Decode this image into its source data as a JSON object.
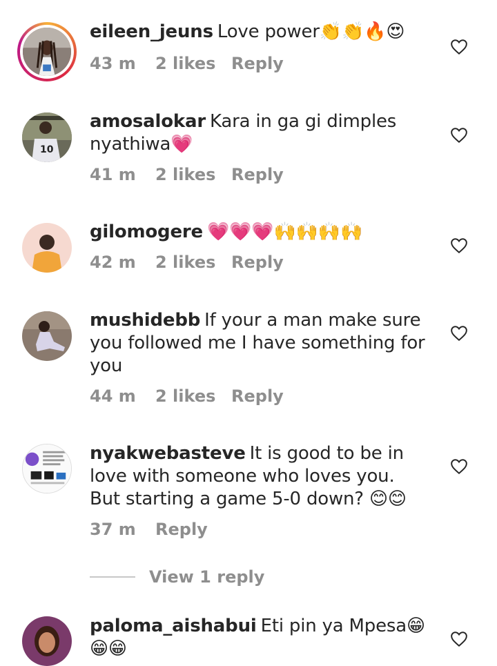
{
  "comments": [
    {
      "username": "eileen_jeuns",
      "text": "Love power",
      "emojis": "👏👏🔥😍",
      "time": "43 m",
      "likes": "2 likes",
      "reply": "Reply",
      "has_story": true,
      "avatar_icon": "avatar-photo-woman-braids"
    },
    {
      "username": "amosalokar",
      "text": "Kara in ga gi dimples nyathiwa",
      "emojis": "💗",
      "time": "41 m",
      "likes": "2 likes",
      "reply": "Reply",
      "has_story": false,
      "avatar_icon": "avatar-photo-jersey-10"
    },
    {
      "username": "gilomogere",
      "text": "",
      "emojis": "💗💗💗🙌🙌🙌🙌",
      "time": "42 m",
      "likes": "2 likes",
      "reply": "Reply",
      "has_story": false,
      "avatar_icon": "avatar-photo-man-yellow-shirt"
    },
    {
      "username": "mushidebb",
      "text": "If your a man make sure you followed me I have something for you",
      "emojis": "",
      "time": "44 m",
      "likes": "2 likes",
      "reply": "Reply",
      "has_story": false,
      "avatar_icon": "avatar-photo-woman-sitting"
    },
    {
      "username": "nyakwebasteve",
      "text": "It is good to be in love with someone who loves you. But starting a game 5-0 down?",
      "emojis": "😊😊",
      "time": "37 m",
      "likes": "",
      "reply": "Reply",
      "has_story": false,
      "avatar_icon": "avatar-flyer-image"
    },
    {
      "username": "paloma_aishabui",
      "text": "Eti pin ya Mpesa",
      "emojis": "😁😁😁",
      "time": "",
      "likes": "",
      "reply": "",
      "has_story": false,
      "avatar_icon": "avatar-photo-woman-portrait"
    }
  ],
  "view_replies": "View 1 reply",
  "colors": {
    "text": "#262626",
    "meta": "#8e8e8e",
    "story_ring": "#dc2743"
  }
}
